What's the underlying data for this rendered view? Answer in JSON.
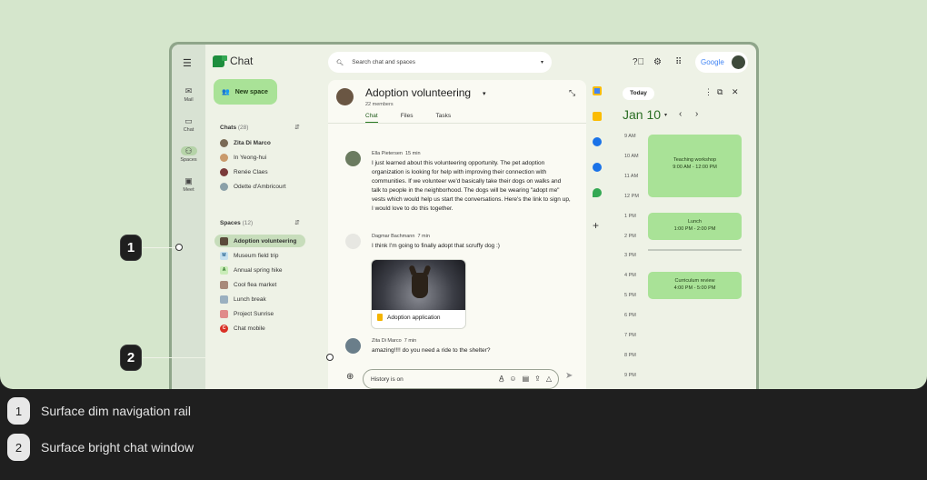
{
  "rail": {
    "items": [
      {
        "label": "Mail",
        "icon": "mail-icon"
      },
      {
        "label": "Chat",
        "icon": "chat-icon"
      },
      {
        "label": "Spaces",
        "icon": "spaces-icon"
      },
      {
        "label": "Meet",
        "icon": "meet-icon"
      }
    ]
  },
  "sidebar": {
    "app_title": "Chat",
    "new_space": "New space",
    "chats_title": "Chats",
    "chats_count": "(28)",
    "chats": [
      "Zita Di Marco",
      "In Yeong-hui",
      "Renée Claes",
      "Odette d'Ambricourt"
    ],
    "spaces_title": "Spaces",
    "spaces_count": "(12)",
    "spaces": [
      {
        "label": "Adoption volunteering",
        "icon_letter": ""
      },
      {
        "label": "Museum field trip",
        "icon_letter": "M"
      },
      {
        "label": "Annual spring hike",
        "icon_letter": "A"
      },
      {
        "label": "Cool flea market",
        "icon_letter": ""
      },
      {
        "label": "Lunch break",
        "icon_letter": ""
      },
      {
        "label": "Project Sunrise",
        "icon_letter": ""
      },
      {
        "label": "Chat mobile",
        "icon_letter": "C"
      }
    ]
  },
  "search": {
    "placeholder": "Search chat and spaces"
  },
  "google_badge": "Google",
  "chat": {
    "title": "Adoption volunteering",
    "members": "22 members",
    "tabs": [
      "Chat",
      "Files",
      "Tasks"
    ],
    "messages": [
      {
        "author": "Ella Pietersen",
        "time": "15 min",
        "text": "I just learned about this volunteering opportunity. The pet adoption organization is looking for help with improving their connection with communities. If we volunteer we'd basically take their dogs on walks and talk to people in the neighborhood. The dogs will be wearing \"adopt me\" vests which would help us start the conversations. Here's the link to sign up, I would love to do this together."
      },
      {
        "author": "Dagmar Bachmann",
        "time": "7 min",
        "text": "I think I'm going to finally adopt that scruffy dog :)"
      },
      {
        "author": "Zita Di Marco",
        "time": "7 min",
        "text": "amazing!!!! do you need a ride to the shelter?"
      }
    ],
    "card_caption": "Adoption application",
    "composer_placeholder": "History is on"
  },
  "calendar": {
    "today": "Today",
    "date": "Jan 10",
    "hours": [
      "9 AM",
      "10 AM",
      "11 AM",
      "12 PM",
      "1 PM",
      "2 PM",
      "3 PM",
      "4 PM",
      "5 PM",
      "6 PM",
      "7 PM",
      "8 PM",
      "9 PM"
    ],
    "events": [
      {
        "title": "Teaching workshop",
        "time": "9:00 AM - 12:00 PM"
      },
      {
        "title": "Lunch",
        "time": "1:00 PM - 2:00 PM"
      },
      {
        "title": "Curriculum review",
        "time": "4:00 PM - 5:00 PM"
      }
    ]
  },
  "callouts": [
    {
      "number": "1",
      "label": "Surface dim navigation rail"
    },
    {
      "number": "2",
      "label": "Surface bright chat window"
    }
  ],
  "colors": {
    "background": "#d5e6cc",
    "rail": "#d8e2d3",
    "chat_surface": "#fafaf3",
    "accent": "#a9e297",
    "footer": "#1f1f1f"
  }
}
